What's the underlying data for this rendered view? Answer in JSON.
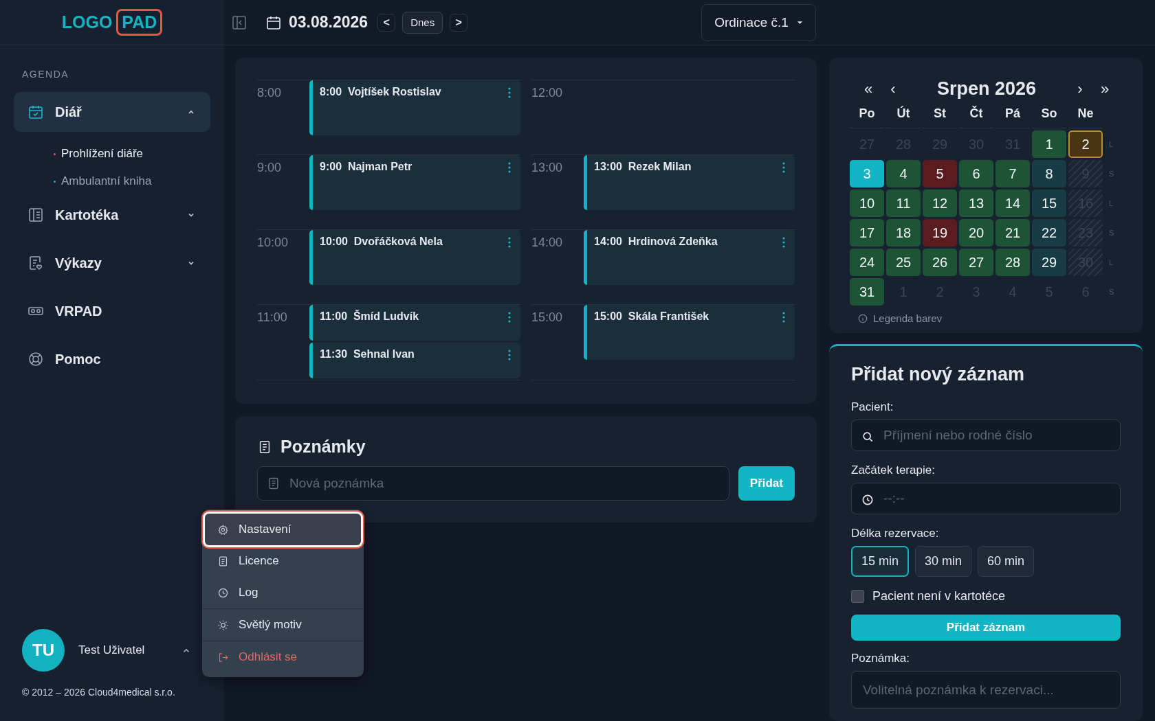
{
  "logo": {
    "text": "LOGO",
    "badge": "PAD"
  },
  "header": {
    "date": "03.08.2026",
    "prev": "<",
    "today_button": "Dnes",
    "next": ">",
    "office": "Ordinace č.1"
  },
  "sidebar": {
    "section": "AGENDA",
    "items": [
      {
        "label": "Diář",
        "selected": true,
        "expanded": true,
        "children": [
          {
            "label": "Prohlížení diáře",
            "selected": true
          },
          {
            "label": "Ambulantní kniha",
            "selected": false
          }
        ]
      },
      {
        "label": "Kartotéka",
        "selected": false,
        "expanded": false
      },
      {
        "label": "Výkazy",
        "selected": false,
        "expanded": false
      },
      {
        "label": "VRPAD",
        "selected": false
      },
      {
        "label": "Pomoc",
        "selected": false
      }
    ],
    "user": {
      "initials": "TU",
      "name": "Test Uživatel",
      "menu_open": true
    },
    "copyright": "© 2012 – 2026 Cloud4medical s.r.o."
  },
  "user_menu": {
    "groups": [
      {
        "items": [
          {
            "label": "Nastavení",
            "kind": "normal",
            "highlighted": true
          },
          {
            "label": "Licence",
            "kind": "normal",
            "highlighted": false
          },
          {
            "label": "Log",
            "kind": "normal",
            "highlighted": false
          }
        ]
      },
      {
        "items": [
          {
            "label": "Světlý motiv",
            "kind": "normal",
            "highlighted": false
          }
        ]
      },
      {
        "items": [
          {
            "label": "Odhlásit se",
            "kind": "danger",
            "highlighted": false
          }
        ]
      }
    ]
  },
  "schedule": {
    "columns": [
      {
        "slots": [
          {
            "time": "8:00",
            "appointments": [
              {
                "time": "8:00",
                "name": "Vojtíšek Rostislav"
              }
            ]
          },
          {
            "time": "9:00",
            "appointments": [
              {
                "time": "9:00",
                "name": "Najman Petr"
              }
            ]
          },
          {
            "time": "10:00",
            "appointments": [
              {
                "time": "10:00",
                "name": "Dvořáčková Nela"
              }
            ]
          },
          {
            "time": "11:00",
            "appointments": [
              {
                "time": "11:00",
                "name": "Šmíd Ludvík"
              },
              {
                "time": "11:30",
                "name": "Sehnal Ivan"
              }
            ]
          }
        ]
      },
      {
        "slots": [
          {
            "time": "12:00"
          },
          {
            "time": "13:00",
            "appointments": [
              {
                "time": "13:00",
                "name": "Rezek Milan"
              }
            ]
          },
          {
            "time": "14:00",
            "appointments": [
              {
                "time": "14:00",
                "name": "Hrdinová Zdeňka"
              }
            ]
          },
          {
            "time": "15:00",
            "appointments": [
              {
                "time": "15:00",
                "name": "Skála František"
              }
            ]
          }
        ]
      }
    ]
  },
  "notes": {
    "title": "Poznámky",
    "placeholder": "Nová poznámka",
    "button": "Přidat"
  },
  "calendar": {
    "title": "Srpen 2026",
    "nav": [
      "«",
      "‹",
      "›",
      "»"
    ],
    "weekdays": [
      "Po",
      "Út",
      "St",
      "Čt",
      "Pá",
      "So",
      "Ne"
    ],
    "weeks": [
      {
        "side": "L",
        "days": [
          {
            "label": "27",
            "kind": "outside"
          },
          {
            "label": "28",
            "kind": "outside"
          },
          {
            "label": "29",
            "kind": "outside"
          },
          {
            "label": "30",
            "kind": "outside"
          },
          {
            "label": "31",
            "kind": "outside"
          },
          {
            "label": "1",
            "kind": "free"
          },
          {
            "label": "2",
            "kind": "holiday"
          }
        ]
      },
      {
        "side": "S",
        "days": [
          {
            "label": "3",
            "kind": "selected"
          },
          {
            "label": "4",
            "kind": "free"
          },
          {
            "label": "5",
            "kind": "full"
          },
          {
            "label": "6",
            "kind": "free"
          },
          {
            "label": "7",
            "kind": "free"
          },
          {
            "label": "8",
            "kind": "weekend"
          },
          {
            "label": "9",
            "kind": "closed"
          }
        ]
      },
      {
        "side": "L",
        "days": [
          {
            "label": "10",
            "kind": "free"
          },
          {
            "label": "11",
            "kind": "free"
          },
          {
            "label": "12",
            "kind": "free"
          },
          {
            "label": "13",
            "kind": "free"
          },
          {
            "label": "14",
            "kind": "free"
          },
          {
            "label": "15",
            "kind": "weekend"
          },
          {
            "label": "16",
            "kind": "closed"
          }
        ]
      },
      {
        "side": "S",
        "days": [
          {
            "label": "17",
            "kind": "free"
          },
          {
            "label": "18",
            "kind": "free"
          },
          {
            "label": "19",
            "kind": "full"
          },
          {
            "label": "20",
            "kind": "free"
          },
          {
            "label": "21",
            "kind": "free"
          },
          {
            "label": "22",
            "kind": "weekend"
          },
          {
            "label": "23",
            "kind": "closed"
          }
        ]
      },
      {
        "side": "L",
        "days": [
          {
            "label": "24",
            "kind": "free"
          },
          {
            "label": "25",
            "kind": "free"
          },
          {
            "label": "26",
            "kind": "free"
          },
          {
            "label": "27",
            "kind": "free"
          },
          {
            "label": "28",
            "kind": "free"
          },
          {
            "label": "29",
            "kind": "weekend"
          },
          {
            "label": "30",
            "kind": "closed"
          }
        ]
      },
      {
        "side": "S",
        "days": [
          {
            "label": "31",
            "kind": "free"
          },
          {
            "label": "1",
            "kind": "outside"
          },
          {
            "label": "2",
            "kind": "outside"
          },
          {
            "label": "3",
            "kind": "outside"
          },
          {
            "label": "4",
            "kind": "outside"
          },
          {
            "label": "5",
            "kind": "outside"
          },
          {
            "label": "6",
            "kind": "outside"
          }
        ]
      }
    ],
    "legend": "Legenda barev"
  },
  "form": {
    "title": "Přidat nový záznam",
    "patient": {
      "label": "Pacient:",
      "placeholder": "Příjmení nebo rodné číslo"
    },
    "start": {
      "label": "Začátek terapie:",
      "placeholder": "--:--"
    },
    "duration": {
      "label": "Délka rezervace:",
      "options": [
        {
          "label": "15 min",
          "selected": true
        },
        {
          "label": "30 min",
          "selected": false
        },
        {
          "label": "60 min",
          "selected": false
        }
      ]
    },
    "not_in_registry": {
      "label": "Pacient není v kartotéce",
      "checked": false
    },
    "submit": "Přidat záznam",
    "note": {
      "label": "Poznámka:",
      "placeholder": "Volitelná poznámka k rezervaci..."
    }
  }
}
